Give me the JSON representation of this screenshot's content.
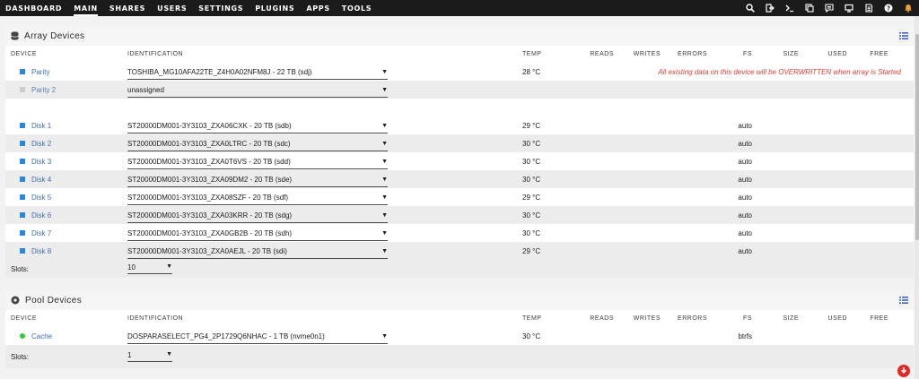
{
  "nav": {
    "items": [
      {
        "label": "DASHBOARD",
        "active": false
      },
      {
        "label": "MAIN",
        "active": true
      },
      {
        "label": "SHARES",
        "active": false
      },
      {
        "label": "USERS",
        "active": false
      },
      {
        "label": "SETTINGS",
        "active": false
      },
      {
        "label": "PLUGINS",
        "active": false
      },
      {
        "label": "APPS",
        "active": false
      },
      {
        "label": "TOOLS",
        "active": false
      }
    ],
    "icons": [
      "search-icon",
      "logout-icon",
      "terminal-icon",
      "copy-icon",
      "feedback-icon",
      "monitor-icon",
      "log-icon",
      "help-icon",
      "bell-icon"
    ],
    "bell_color": "#f0a030"
  },
  "headers": {
    "device": "DEVICE",
    "identification": "IDENTIFICATION",
    "temp": "TEMP",
    "reads": "READS",
    "writes": "WRITES",
    "errors": "ERRORS",
    "fs": "FS",
    "size": "SIZE",
    "used": "USED",
    "free": "FREE"
  },
  "array": {
    "title": "Array Devices",
    "parity": [
      {
        "name": "Parity",
        "id": "TOSHIBA_MG10AFA22TE_Z4H0A02NFM8J - 22 TB (sdj)",
        "temp": "28 °C",
        "warning": "All existing data on this device will be OVERWRITTEN when array is Started"
      },
      {
        "name": "Parity 2",
        "id": "unassigned",
        "temp": ""
      }
    ],
    "disks": [
      {
        "name": "Disk 1",
        "id": "ST20000DM001-3Y3103_ZXA06CXK - 20 TB (sdb)",
        "temp": "29 °C",
        "fs": "auto"
      },
      {
        "name": "Disk 2",
        "id": "ST20000DM001-3Y3103_ZXA0LTRC - 20 TB (sdc)",
        "temp": "30 °C",
        "fs": "auto"
      },
      {
        "name": "Disk 3",
        "id": "ST20000DM001-3Y3103_ZXA0T6VS - 20 TB (sdd)",
        "temp": "30 °C",
        "fs": "auto"
      },
      {
        "name": "Disk 4",
        "id": "ST20000DM001-3Y3103_ZXA09DM2 - 20 TB (sde)",
        "temp": "30 °C",
        "fs": "auto"
      },
      {
        "name": "Disk 5",
        "id": "ST20000DM001-3Y3103_ZXA08SZF - 20 TB (sdf)",
        "temp": "29 °C",
        "fs": "auto"
      },
      {
        "name": "Disk 6",
        "id": "ST20000DM001-3Y3103_ZXA03KRR - 20 TB (sdg)",
        "temp": "30 °C",
        "fs": "auto"
      },
      {
        "name": "Disk 7",
        "id": "ST20000DM001-3Y3103_ZXA0GB2B - 20 TB (sdh)",
        "temp": "30 °C",
        "fs": "auto"
      },
      {
        "name": "Disk 8",
        "id": "ST20000DM001-3Y3103_ZXA0AEJL - 20 TB (sdi)",
        "temp": "29 °C",
        "fs": "auto"
      }
    ],
    "slots_label": "Slots:",
    "slots_value": "10"
  },
  "pool": {
    "title": "Pool Devices",
    "devices": [
      {
        "name": "Cache",
        "id": "DOSPARASELECT_PG4_2P1729Q6NHAC - 1 TB (nvme0n1)",
        "temp": "30 °C",
        "fs": "btrfs"
      }
    ],
    "slots_label": "Slots:",
    "slots_value": "1"
  },
  "colors": {
    "accent": "#3e6fb6",
    "warning": "#e23b3b",
    "online": "#33cc33",
    "disk": "#2a86e0"
  }
}
